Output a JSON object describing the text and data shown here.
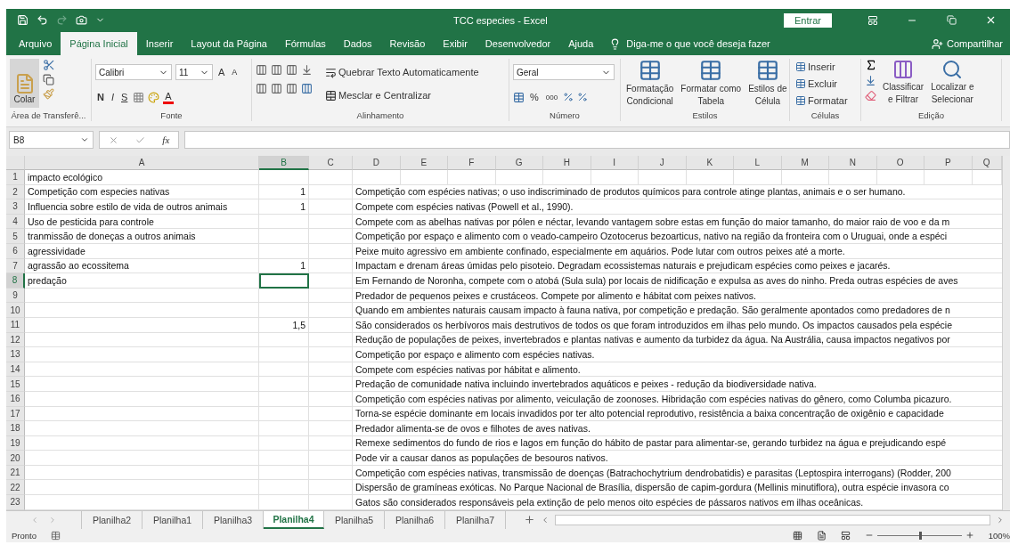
{
  "title_bar": {
    "title": "TCC especies  -  Excel",
    "sign_in": "Entrar"
  },
  "ribbon_tabs": [
    {
      "label": "Arquivo",
      "selected": false
    },
    {
      "label": "Página Inicial",
      "selected": true
    },
    {
      "label": "Inserir",
      "selected": false
    },
    {
      "label": "Layout da Página",
      "selected": false
    },
    {
      "label": "Fórmulas",
      "selected": false
    },
    {
      "label": "Dados",
      "selected": false
    },
    {
      "label": "Revisão",
      "selected": false
    },
    {
      "label": "Exibir",
      "selected": false
    },
    {
      "label": "Desenvolvedor",
      "selected": false
    },
    {
      "label": "Ajuda",
      "selected": false
    }
  ],
  "tell_me": "Diga-me o que você deseja fazer",
  "share": "Compartilhar",
  "ribbon": {
    "clipboard": {
      "paste": "Colar",
      "label": "Área de Transferê..."
    },
    "font": {
      "font_name": "Calibri",
      "font_size": "11",
      "bold": "N",
      "italic": "I",
      "underline": "S",
      "grow": "A",
      "shrink": "A",
      "color_letter": "A",
      "label": "Fonte"
    },
    "alignment": {
      "wrap": "Quebrar Texto Automaticamente",
      "merge": "Mesclar e Centralizar",
      "label": "Alinhamento"
    },
    "number": {
      "format": "Geral",
      "percent": "%",
      "thousands": "000",
      "label": "Número"
    },
    "styles": {
      "buttons": [
        {
          "lines": [
            "Formatação",
            "Condicional"
          ]
        },
        {
          "lines": [
            "Formatar como",
            "Tabela"
          ]
        },
        {
          "lines": [
            "Estilos de",
            "Célula"
          ]
        }
      ],
      "label": "Estilos"
    },
    "cells": {
      "buttons": [
        "Inserir",
        "Excluir",
        "Formatar"
      ],
      "label": "Células"
    },
    "editing": {
      "buttons": [
        {
          "lines": [
            "Classificar",
            "e Filtrar"
          ]
        },
        {
          "lines": [
            "Localizar e",
            "Selecionar"
          ]
        }
      ],
      "label": "Edição"
    }
  },
  "formula_bar": {
    "name_box": "B8",
    "fx": "fx"
  },
  "columns": [
    {
      "label": "A",
      "selected": false
    },
    {
      "label": "B",
      "selected": true
    },
    {
      "label": "C",
      "selected": false
    },
    {
      "label": "D",
      "selected": false
    },
    {
      "label": "E",
      "selected": false
    },
    {
      "label": "F",
      "selected": false
    },
    {
      "label": "G",
      "selected": false
    },
    {
      "label": "H",
      "selected": false
    },
    {
      "label": "I",
      "selected": false
    },
    {
      "label": "J",
      "selected": false
    },
    {
      "label": "K",
      "selected": false
    },
    {
      "label": "L",
      "selected": false
    },
    {
      "label": "M",
      "selected": false
    },
    {
      "label": "N",
      "selected": false
    },
    {
      "label": "O",
      "selected": false
    },
    {
      "label": "P",
      "selected": false
    },
    {
      "label": "Q",
      "selected": false
    }
  ],
  "rows": [
    {
      "number": "1",
      "selected": false,
      "a": "impacto ecológico"
    },
    {
      "number": "2",
      "selected": false,
      "a": "Competição com especies nativas",
      "b": "1",
      "d": "Competição com espécies nativas; o uso indiscriminado de produtos químicos para  controle atinge plantas, animais e o ser humano."
    },
    {
      "number": "3",
      "selected": false,
      "a": "Influencia sobre estilo de vida de  outros animais",
      "b": "1",
      "d": "Compete com espécies nativas (Powell et al., 1990)."
    },
    {
      "number": "4",
      "selected": false,
      "a": "Uso de pesticida para controle",
      "d": "Compete com as abelhas nativas por pólen e néctar, levando vantagem sobre estas em função do maior tamanho, do maior raio de voo e da m"
    },
    {
      "number": "5",
      "selected": false,
      "a": "tranmissão de doneças a outros animais",
      "d": "Competição por espaço e alimento com o veado-campeiro Ozotocerus bezoarticus, nativo na região da fronteira com o Uruguai, onde a espéci"
    },
    {
      "number": "6",
      "selected": false,
      "a": "agressividade",
      "d": "Peixe muito agressivo em ambiente confinado, especialmente em aquários. Pode lutar com outros peixes até a morte."
    },
    {
      "number": "7",
      "selected": false,
      "a": "agrassão ao ecossitema",
      "b": "1",
      "d": "Impactam e drenam áreas úmidas pelo pisoteio. Degradam ecossistemas naturais e prejudicam espécies como peixes e jacarés."
    },
    {
      "number": "8",
      "selected": true,
      "a": "predação",
      "d": "Em Fernando de Noronha, compete com o atobá (Sula sula) por locais de nidificação e expulsa as aves do ninho. Preda outras espécies de aves"
    },
    {
      "number": "9",
      "selected": false,
      "d": "Predador de pequenos peixes e crustáceos. Compete por alimento e hábitat com peixes nativos."
    },
    {
      "number": "10",
      "selected": false,
      "d": "Quando em ambientes naturais causam impacto à fauna nativa, por competição e predação. São geralmente apontados como predadores de n"
    },
    {
      "number": "11",
      "selected": false,
      "b": "1,5",
      "d": "São considerados os herbívoros mais destrutivos de todos os que foram introduzidos em ilhas pelo mundo. Os impactos causados pela espécie"
    },
    {
      "number": "12",
      "selected": false,
      "d": "Redução de populações de peixes, invertebrados e plantas nativas e aumento da turbidez da água. Na Austrália, causa impactos negativos por"
    },
    {
      "number": "13",
      "selected": false,
      "d": "Competição por espaço e alimento com espécies nativas."
    },
    {
      "number": "14",
      "selected": false,
      "d": "Compete com espécies nativas por hábitat e alimento."
    },
    {
      "number": "15",
      "selected": false,
      "d": "Predação de comunidade nativa incluindo invertebrados aquáticos e peixes - redução da biodiversidade nativa."
    },
    {
      "number": "16",
      "selected": false,
      "d": "Competição com espécies nativas por alimento, veiculação de zoonoses. Hibridação com espécies nativas do gênero, como Columba picazuro."
    },
    {
      "number": "17",
      "selected": false,
      "d": "Torna-se espécie dominante em locais invadidos por ter alto potencial reprodutivo, resistência a baixa concentração de oxigênio e capacidade"
    },
    {
      "number": "18",
      "selected": false,
      "d": "Predador alimenta-se de ovos e filhotes de aves nativas."
    },
    {
      "number": "19",
      "selected": false,
      "d": "Remexe sedimentos do fundo de rios e lagos em função do hábito de pastar para alimentar-se, gerando turbidez na água e prejudicando espé"
    },
    {
      "number": "20",
      "selected": false,
      "d": "Pode vir a causar danos as populações de besouros nativos."
    },
    {
      "number": "21",
      "selected": false,
      "d": "Competição com espécies nativas, transmissão de doenças (Batrachochytrium dendrobatidis) e parasitas (Leptospira interrogans) (Rodder, 200"
    },
    {
      "number": "22",
      "selected": false,
      "d": "Dispersão de gramíneas exóticas. No Parque Nacional de Brasília, dispersão de capim-gordura (Mellinis minutiflora), outra espécie invasora co"
    },
    {
      "number": "23",
      "selected": false,
      "d": "Gatos são considerados responsáveis pela extinção de pelo menos oito espécies de pássaros nativos em ilhas oceânicas."
    }
  ],
  "sheet_tabs": [
    {
      "label": "Planilha2",
      "selected": false
    },
    {
      "label": "Planilha1",
      "selected": false
    },
    {
      "label": "Planilha3",
      "selected": false
    },
    {
      "label": "Planilha4",
      "selected": true
    },
    {
      "label": "Planilha5",
      "selected": false
    },
    {
      "label": "Planilha6",
      "selected": false
    },
    {
      "label": "Planilha7",
      "selected": false
    }
  ],
  "status_bar": {
    "status": "Pronto",
    "zoom": "100%",
    "level": 0.5
  }
}
